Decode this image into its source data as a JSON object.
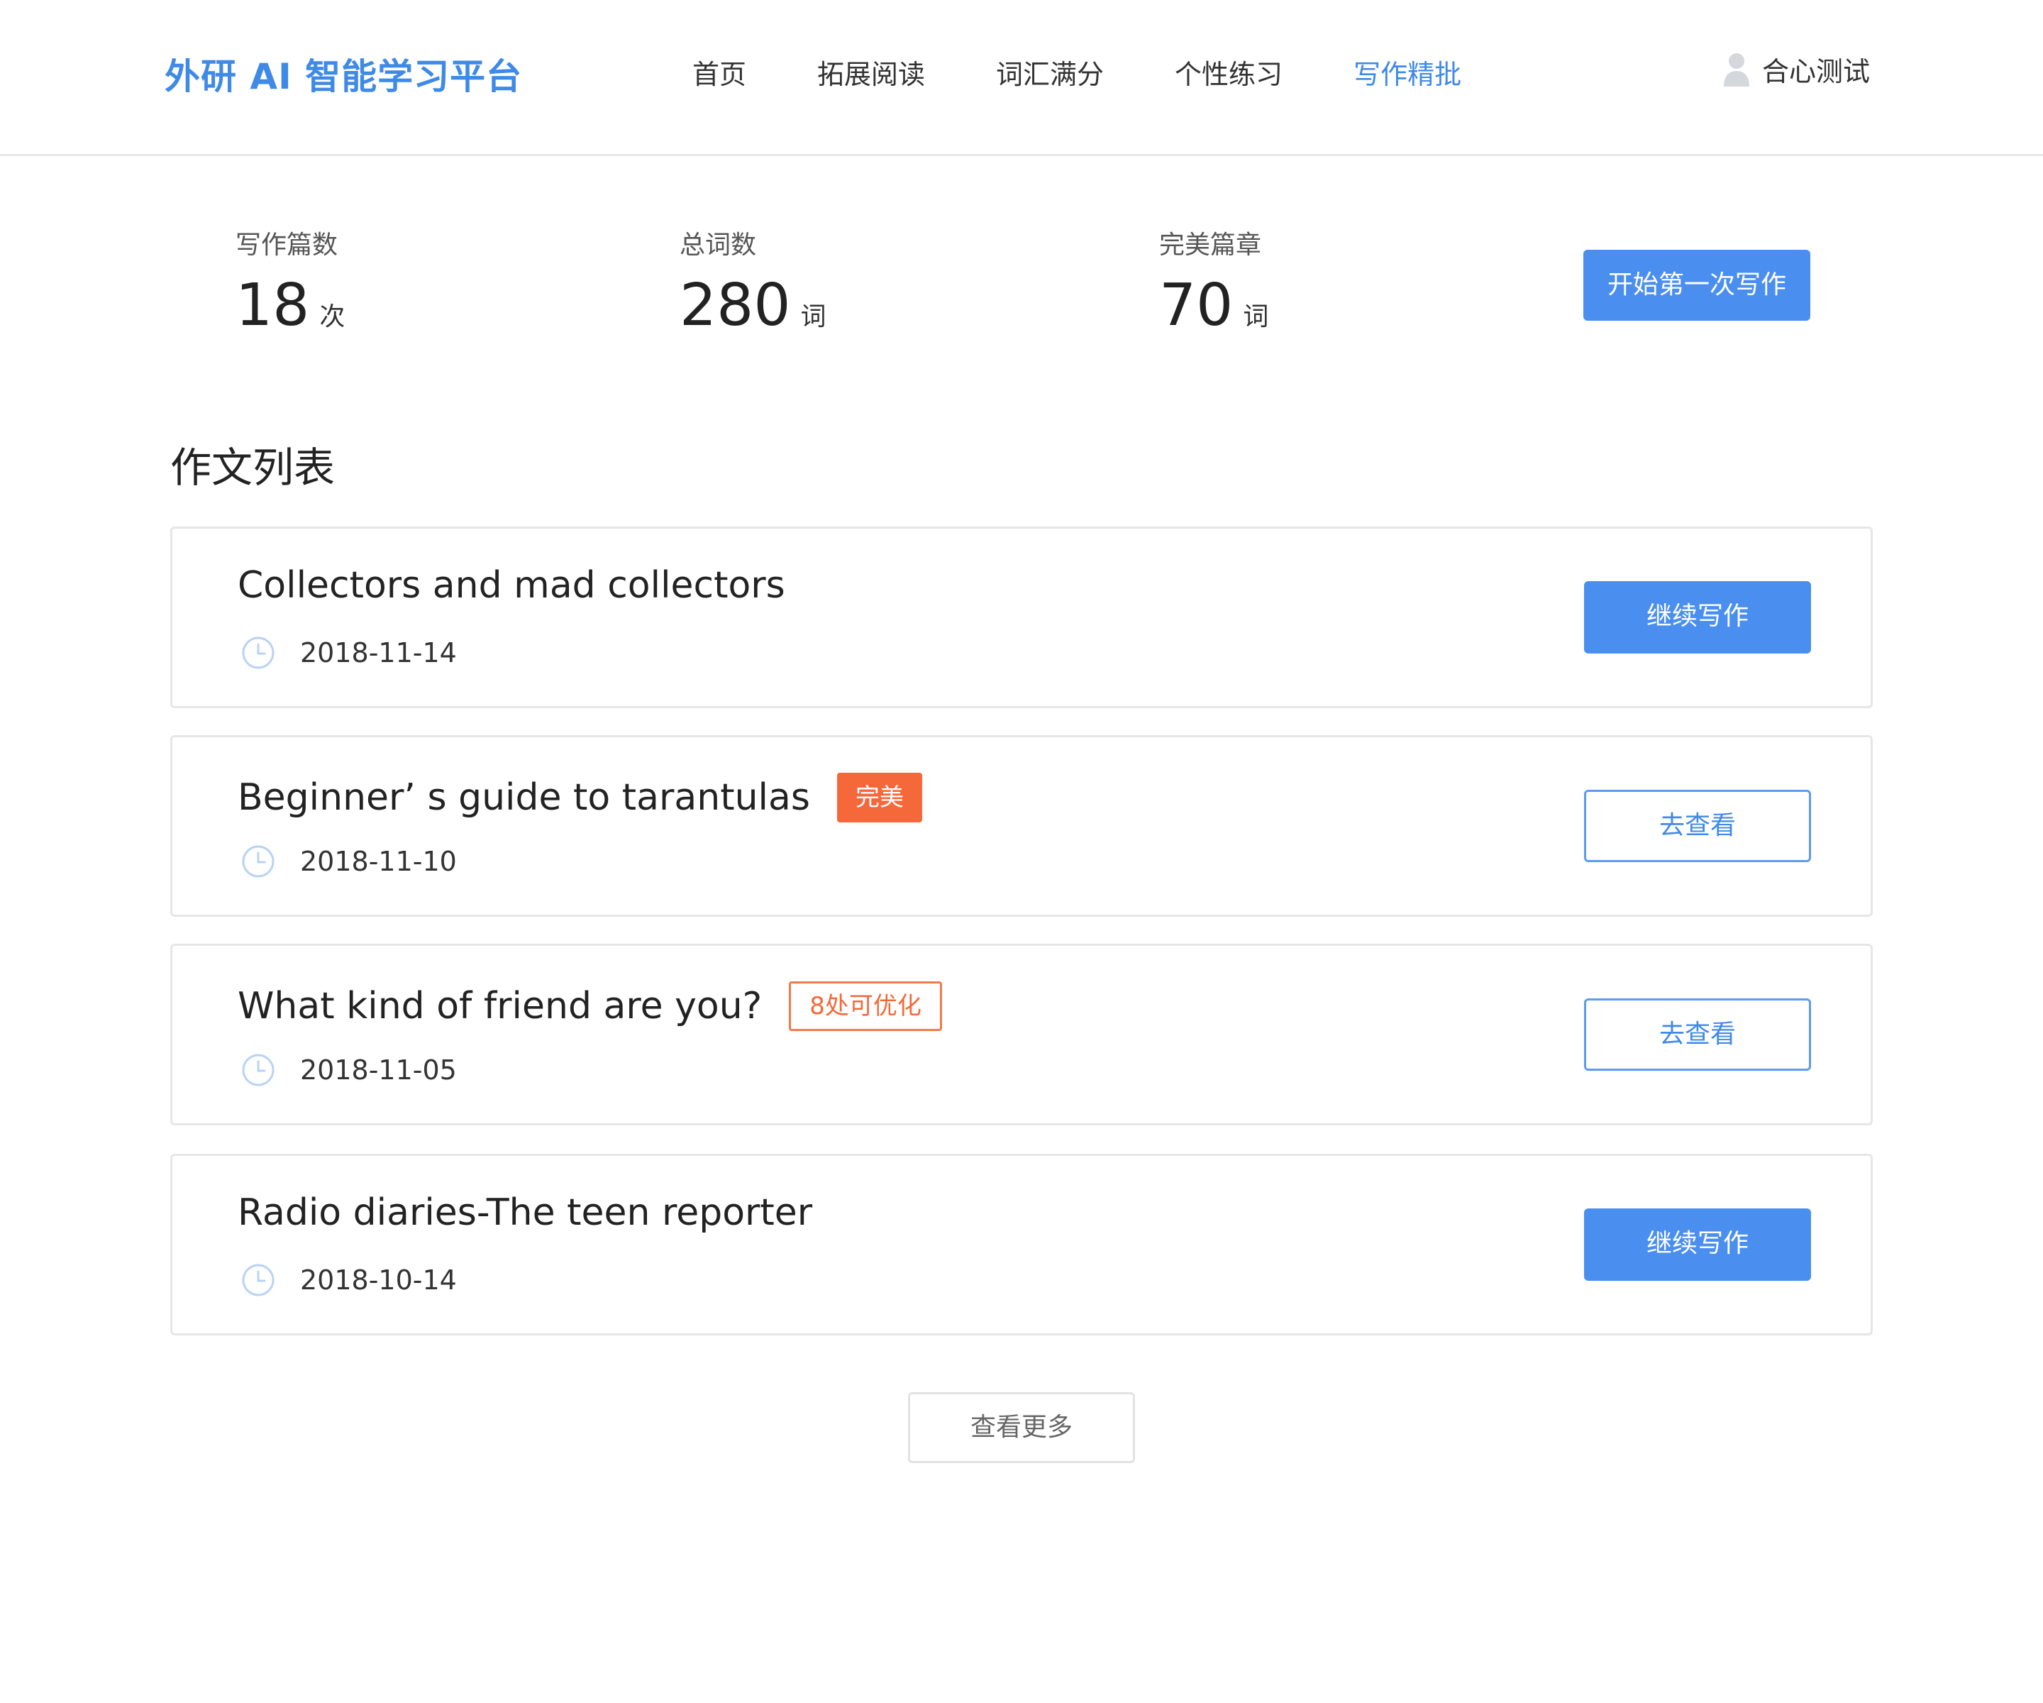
{
  "header": {
    "brand": "外研 AI 智能学习平台",
    "nav": [
      "首页",
      "拓展阅读",
      "词汇满分",
      "个性练习",
      "写作精批"
    ],
    "active_nav": "写作精批",
    "user_name": "合心测试",
    "user_icon": "user-icon"
  },
  "stats": [
    {
      "label": "写作篇数",
      "value": "18",
      "unit": "次"
    },
    {
      "label": "总词数",
      "value": "280",
      "unit": "词"
    },
    {
      "label": "完美篇章",
      "value": "70",
      "unit": "词"
    }
  ],
  "start_button": "开始第一次写作",
  "section_title": "作文列表",
  "essays": [
    {
      "title": "Collectors and mad collectors",
      "date": "2018-11-14",
      "tag": "",
      "tag_style": "",
      "action": "继续写作",
      "action_style": "primary"
    },
    {
      "title": "Beginner’ s guide to tarantulas",
      "date": "2018-11-10",
      "tag": "完美",
      "tag_style": "solid",
      "action": "去查看",
      "action_style": "outline"
    },
    {
      "title": "What kind of friend are you?",
      "date": "2018-11-05",
      "tag": "8处可优化",
      "tag_style": "outline",
      "action": "去查看",
      "action_style": "outline"
    },
    {
      "title": "Radio diaries-The teen reporter",
      "date": "2018-10-14",
      "tag": "",
      "tag_style": "",
      "action": "继续写作",
      "action_style": "primary"
    }
  ],
  "more_button": "查看更多",
  "colors": {
    "accent": "#4a8ff0",
    "tag_orange": "#f4683a",
    "border": "#e6e6e6"
  },
  "icons": {
    "clock": "clock-icon",
    "user": "user-icon"
  }
}
